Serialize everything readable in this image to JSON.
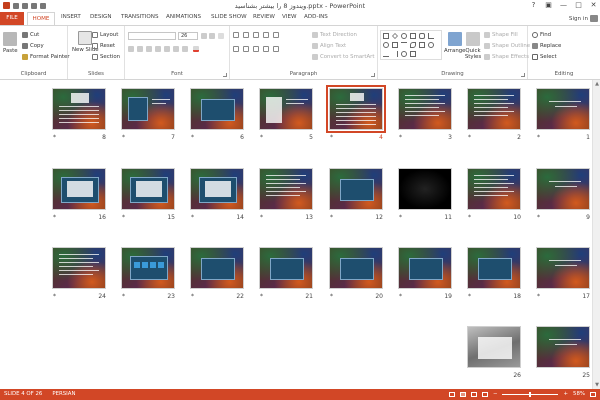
{
  "app": {
    "title": "ویندوز 8 را بیشتر بشناسید.pptx - PowerPoint",
    "signin": "Sign in",
    "window_controls": [
      "?",
      "▣",
      "—",
      "□",
      "✕"
    ]
  },
  "tabs": [
    "FILE",
    "HOME",
    "INSERT",
    "DESIGN",
    "TRANSITIONS",
    "ANIMATIONS",
    "SLIDE SHOW",
    "REVIEW",
    "VIEW",
    "ADD-INS"
  ],
  "ribbon": {
    "clipboard": {
      "label": "Clipboard",
      "paste": "Paste",
      "cut": "Cut",
      "copy": "Copy",
      "format_painter": "Format Painter"
    },
    "slides": {
      "label": "Slides",
      "new_slide": "New Slide",
      "layout": "Layout",
      "reset": "Reset",
      "section": "Section"
    },
    "font": {
      "label": "Font",
      "size": "26"
    },
    "paragraph": {
      "label": "Paragraph",
      "text_direction": "Text Direction",
      "align_text": "Align Text",
      "convert_smartart": "Convert to SmartArt"
    },
    "drawing": {
      "label": "Drawing",
      "arrange": "Arrange",
      "quick_styles": "Quick Styles",
      "shape_fill": "Shape Fill",
      "shape_outline": "Shape Outline",
      "shape_effects": "Shape Effects"
    },
    "editing": {
      "label": "Editing",
      "find": "Find",
      "replace": "Replace",
      "select": "Select"
    }
  },
  "slides": [
    {
      "n": "1"
    },
    {
      "n": "2"
    },
    {
      "n": "3"
    },
    {
      "n": "4"
    },
    {
      "n": "5"
    },
    {
      "n": "6"
    },
    {
      "n": "7"
    },
    {
      "n": "8"
    },
    {
      "n": "9"
    },
    {
      "n": "10"
    },
    {
      "n": "11"
    },
    {
      "n": "12"
    },
    {
      "n": "13"
    },
    {
      "n": "14"
    },
    {
      "n": "15"
    },
    {
      "n": "16"
    },
    {
      "n": "17"
    },
    {
      "n": "18"
    },
    {
      "n": "19"
    },
    {
      "n": "20"
    },
    {
      "n": "21"
    },
    {
      "n": "22"
    },
    {
      "n": "23"
    },
    {
      "n": "24"
    },
    {
      "n": "25"
    },
    {
      "n": "26"
    }
  ],
  "slide_star": "*",
  "status": {
    "slide_info": "SLIDE 4 OF 26",
    "language": "PERSIAN",
    "zoom_minus": "−",
    "zoom_plus": "+",
    "zoom": "58%"
  },
  "colors": {
    "accent": "#d24726",
    "selected_number": "#d24726"
  }
}
